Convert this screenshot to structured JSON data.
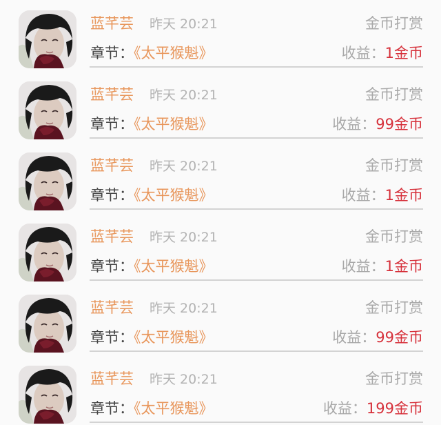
{
  "records": [
    {
      "user_name": "蓝芊芸",
      "time": "昨天 20:21",
      "type": "金币打赏",
      "chapter_label": "章节：",
      "chapter_title": "《太平猴魁》",
      "income_label": "收益：",
      "income_amount": "1金币"
    },
    {
      "user_name": "蓝芊芸",
      "time": "昨天 20:21",
      "type": "金币打赏",
      "chapter_label": "章节：",
      "chapter_title": "《太平猴魁》",
      "income_label": "收益：",
      "income_amount": "99金币"
    },
    {
      "user_name": "蓝芊芸",
      "time": "昨天 20:21",
      "type": "金币打赏",
      "chapter_label": "章节：",
      "chapter_title": "《太平猴魁》",
      "income_label": "收益：",
      "income_amount": "1金币"
    },
    {
      "user_name": "蓝芊芸",
      "time": "昨天 20:21",
      "type": "金币打赏",
      "chapter_label": "章节：",
      "chapter_title": "《太平猴魁》",
      "income_label": "收益：",
      "income_amount": "1金币"
    },
    {
      "user_name": "蓝芊芸",
      "time": "昨天 20:21",
      "type": "金币打赏",
      "chapter_label": "章节：",
      "chapter_title": "《太平猴魁》",
      "income_label": "收益：",
      "income_amount": "99金币"
    },
    {
      "user_name": "蓝芊芸",
      "time": "昨天 20:21",
      "type": "金币打赏",
      "chapter_label": "章节：",
      "chapter_title": "《太平猴魁》",
      "income_label": "收益：",
      "income_amount": "199金币"
    }
  ],
  "colors": {
    "name_accent": "#e8965b",
    "amount_accent": "#d6303a",
    "muted_text": "#a8a8a8",
    "divider": "#d3d3d3"
  },
  "icons": {
    "avatar": "user-photo-avatar"
  }
}
